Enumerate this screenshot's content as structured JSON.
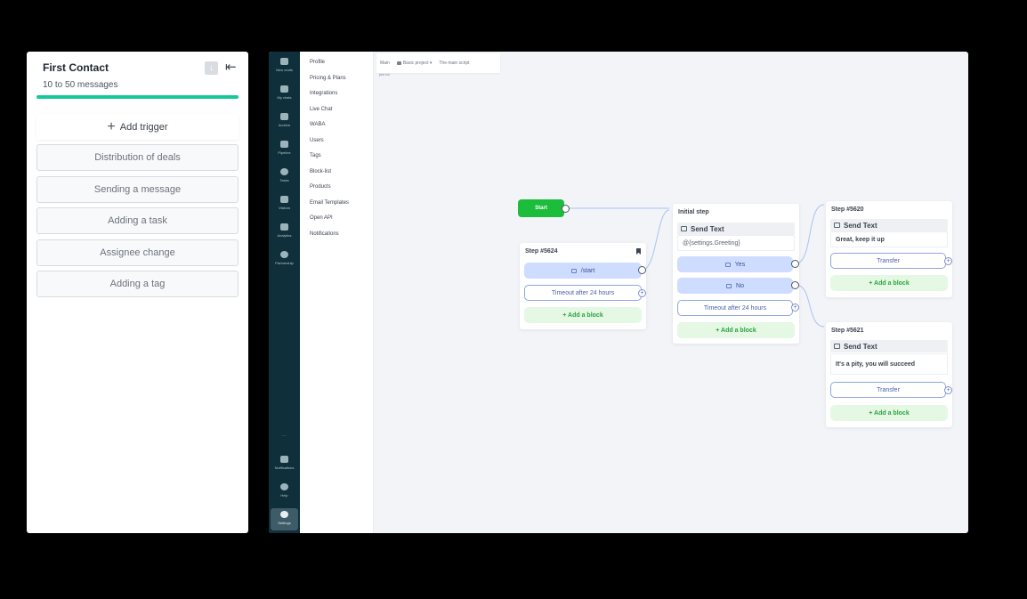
{
  "trigger_panel": {
    "title": "First Contact",
    "subtitle": "10 to 50 messages",
    "progress_color": "#16c79a",
    "add_trigger_label": "Add trigger",
    "triggers": [
      "Distribution of deals",
      "Sending a message",
      "Adding a task",
      "Assignee change",
      "Adding a tag"
    ]
  },
  "nav": {
    "items": [
      "New chats",
      "My chats",
      "Archive",
      "Pipeline",
      "Tasks",
      "Visitors",
      "Analytics",
      "Partnership"
    ],
    "bottom_items": [
      "Notifications",
      "Help",
      "Settings"
    ],
    "dots": "..."
  },
  "settings_menu": {
    "items": [
      "Profile",
      "Pricing & Plans",
      "Integrations",
      "Live Chat",
      "WABA",
      "Users",
      "Tags",
      "Block-list",
      "Products",
      "Email Templates",
      "Open API",
      "Notifications"
    ]
  },
  "canvas": {
    "crumbs": {
      "c1": "Main",
      "c2": "Basic project",
      "c3": "The main script"
    },
    "crumb_note": "join lot",
    "start_label": "Start",
    "step_5624": {
      "title": "Step #5624",
      "start_cmd": "/start",
      "timeout": "Timeout after 24 hours",
      "add_block": "+ Add a block"
    },
    "initial_step": {
      "title": "Initial step",
      "send_text": "Send Text",
      "text": "@{settings.Greeting}",
      "yes": "Yes",
      "no": "No",
      "timeout": "Timeout after 24 hours",
      "add_block": "+ Add a block"
    },
    "step_5620": {
      "title": "Step #5620",
      "send_text": "Send Text",
      "text": "Great, keep it up",
      "transfer": "Transfer",
      "add_block": "+ Add a block"
    },
    "step_5621": {
      "title": "Step #5621",
      "send_text": "Send Text",
      "text": "It's a pity, you will succeed",
      "transfer": "Transfer",
      "add_block": "+ Add a block"
    }
  },
  "colors": {
    "nav_bg": "#0f2f3b",
    "start_green": "#1dbd3c",
    "pill_blue": "#cddcff",
    "add_green": "#2ca342"
  }
}
